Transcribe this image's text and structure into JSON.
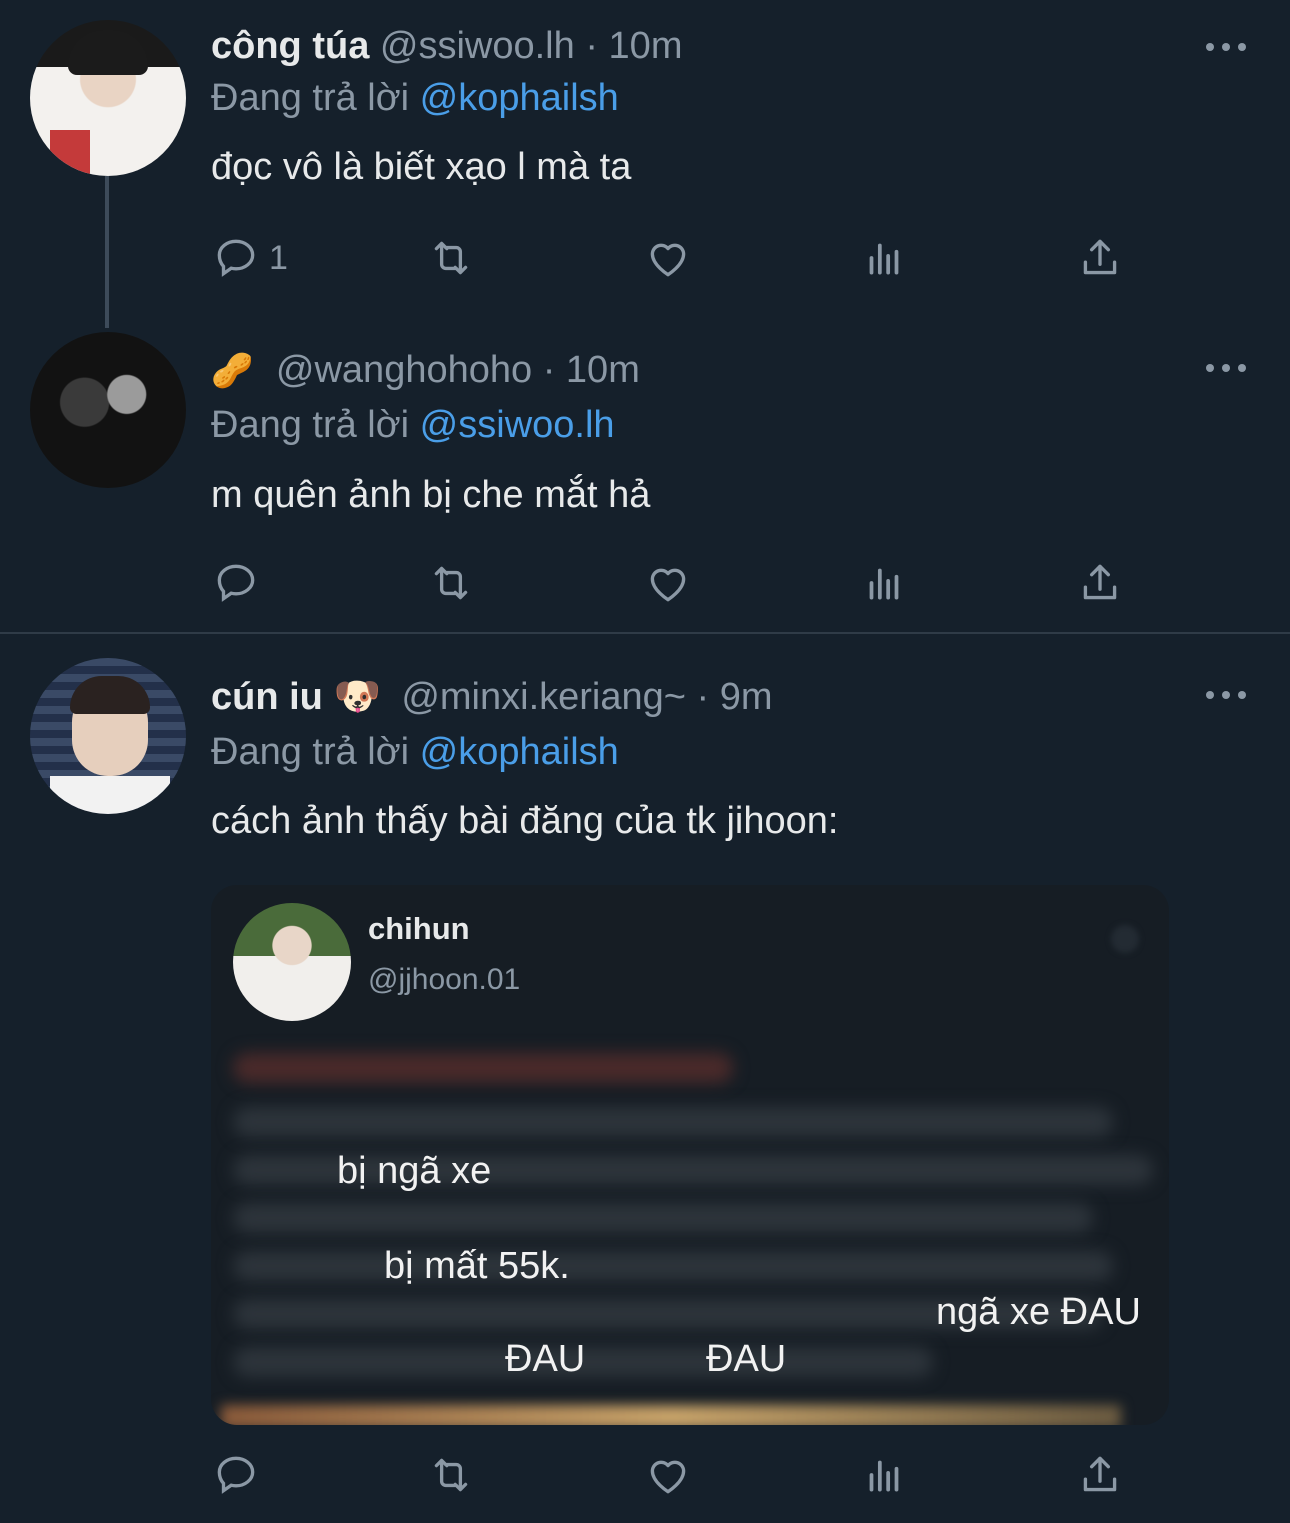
{
  "tweets": [
    {
      "name": "công túa",
      "handle": "@ssiwoo.lh",
      "time": "10m",
      "reply_prefix": "Đang trả lời",
      "reply_to": "@kophailsh",
      "text": "đọc vô là biết xạo l mà ta",
      "reply_count": "1"
    },
    {
      "name": "🥜",
      "handle": "@wanghohoho",
      "time": "10m",
      "reply_prefix": "Đang trả lời",
      "reply_to": "@ssiwoo.lh",
      "text": "m quên ảnh bị che mắt hả"
    },
    {
      "name": "cún iu 🐶",
      "handle": "@minxi.keriang~",
      "time": "9m",
      "reply_prefix": "Đang trả lời",
      "reply_to": "@kophailsh",
      "text": "cách ảnh thấy bài đăng của tk jihoon:"
    }
  ],
  "embed": {
    "name": "chihun",
    "handle": "@jjhoon.01",
    "overlays": [
      "bị ngã xe",
      "bị mất 55k.",
      "ngã xe ĐAU",
      "ĐAU",
      "ĐAU"
    ]
  },
  "separator": "·",
  "colors": {
    "background": "#15202b",
    "link": "#4a9ee8",
    "muted": "#8b98a5"
  }
}
